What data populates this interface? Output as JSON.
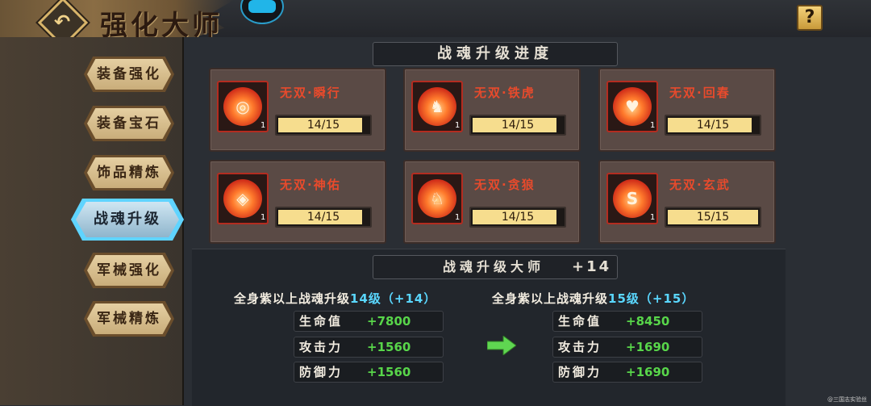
{
  "header": {
    "title": "强化大师",
    "back_label": "↶",
    "help_label": "?"
  },
  "sidebar": {
    "items": [
      {
        "label": "装备强化",
        "active": false
      },
      {
        "label": "装备宝石",
        "active": false
      },
      {
        "label": "饰品精炼",
        "active": false
      },
      {
        "label": "战魂升级",
        "active": true
      },
      {
        "label": "军械强化",
        "active": false
      },
      {
        "label": "军械精炼",
        "active": false
      }
    ]
  },
  "progress": {
    "title": "战魂升级进度",
    "cards": [
      {
        "name": "无双·瞬行",
        "level": "1",
        "progress": "14/15",
        "fraction": 0.933,
        "icon": "flame-swirl-icon",
        "glyph": "◎"
      },
      {
        "name": "无双·铁虎",
        "level": "1",
        "progress": "14/15",
        "fraction": 0.933,
        "icon": "tiger-head-icon",
        "glyph": "♞"
      },
      {
        "name": "无双·回春",
        "level": "1",
        "progress": "14/15",
        "fraction": 0.933,
        "icon": "heart-icon",
        "glyph": "♥"
      },
      {
        "name": "无双·神佑",
        "level": "1",
        "progress": "14/15",
        "fraction": 0.933,
        "icon": "shield-gem-icon",
        "glyph": "◈"
      },
      {
        "name": "无双·贪狼",
        "level": "1",
        "progress": "14/15",
        "fraction": 0.933,
        "icon": "wolf-head-icon",
        "glyph": "♘"
      },
      {
        "name": "无双·玄武",
        "level": "1",
        "progress": "15/15",
        "fraction": 1.0,
        "icon": "turtle-shield-icon",
        "glyph": "S"
      }
    ]
  },
  "master": {
    "title": "战魂升级大师",
    "level": "+14",
    "current": {
      "condition_prefix": "全身紫以上战魂升级",
      "condition_value": "14级（+14）",
      "stats": [
        {
          "label": "生命值",
          "value": "+7800"
        },
        {
          "label": "攻击力",
          "value": "+1560"
        },
        {
          "label": "防御力",
          "value": "+1560"
        }
      ]
    },
    "next": {
      "condition_prefix": "全身紫以上战魂升级",
      "condition_value": "15级（+15）",
      "stats": [
        {
          "label": "生命值",
          "value": "+8450"
        },
        {
          "label": "攻击力",
          "value": "+1690"
        },
        {
          "label": "防御力",
          "value": "+1690"
        }
      ]
    }
  },
  "watermark": "@三国志实验丝",
  "colors": {
    "accent_cyan": "#5ad7ff",
    "stat_green": "#58d64a",
    "skill_name_red": "#e84a2c",
    "progress_fill": "#f6dd8e"
  }
}
